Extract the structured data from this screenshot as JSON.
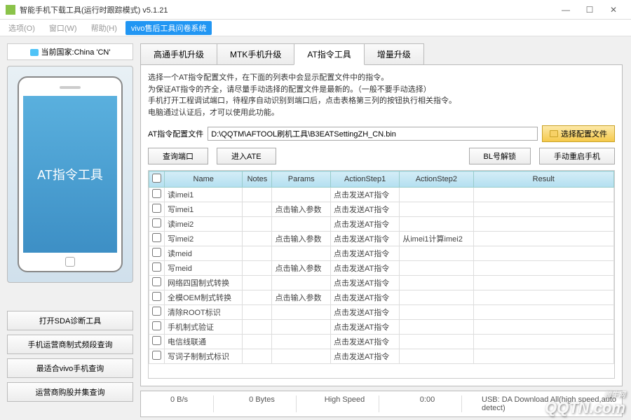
{
  "window": {
    "title": "智能手机下载工具(运行时跟踪模式)  v5.1.21",
    "min": "—",
    "max": "☐",
    "close": "✕"
  },
  "menu": {
    "select": "选项(O)",
    "window": "窗口(W)",
    "help": "帮助(H)",
    "vivo": "vivo售后工具问卷系统"
  },
  "sidebar": {
    "country": "当前国家:China 'CN'",
    "phone_label": "AT指令工具",
    "btns": [
      "打开SDA诊断工具",
      "手机运营商制式频段查询",
      "最适合vivo手机查询",
      "运营商购股并集查询"
    ]
  },
  "tabs": [
    "高通手机升级",
    "MTK手机升级",
    "AT指令工具",
    "增量升级"
  ],
  "panel": {
    "desc_l1": "选择一个AT指令配置文件，在下面的列表中会显示配置文件中的指令。",
    "desc_l2": "为保证AT指令的齐全，请尽量手动选择的配置文件是最新的。（一般不要手动选择）",
    "desc_l3": "手机打开工程调试端口，待程序自动识别到端口后，点击表格第三列的按钮执行相关指令。",
    "desc_l4": "电脑通过认证后，才可以使用此功能。",
    "cfg_label": "AT指令配置文件",
    "cfg_path": "D:\\QQTM\\AFTOOL刷机工具\\B3EATSettingZH_CN.bin",
    "cfg_btn": "选择配置文件",
    "btn_query": "查询端口",
    "btn_ate": "进入ATE",
    "btn_unlock": "BL号解锁",
    "btn_reboot": "手动重启手机",
    "headers": [
      "",
      "Name",
      "Notes",
      "Params",
      "ActionStep1",
      "ActionStep2",
      "Result"
    ],
    "rows": [
      {
        "name": "读imei1",
        "notes": "",
        "params": "",
        "a1": "点击发送AT指令",
        "a2": ""
      },
      {
        "name": "写imei1",
        "notes": "",
        "params": "点击输入参数",
        "a1": "点击发送AT指令",
        "a2": ""
      },
      {
        "name": "读imei2",
        "notes": "",
        "params": "",
        "a1": "点击发送AT指令",
        "a2": ""
      },
      {
        "name": "写imei2",
        "notes": "",
        "params": "点击输入参数",
        "a1": "点击发送AT指令",
        "a2": "从imei1计算imei2"
      },
      {
        "name": "读meid",
        "notes": "",
        "params": "",
        "a1": "点击发送AT指令",
        "a2": ""
      },
      {
        "name": "写meid",
        "notes": "",
        "params": "点击输入参数",
        "a1": "点击发送AT指令",
        "a2": ""
      },
      {
        "name": "网络四国制式转换",
        "notes": "",
        "params": "",
        "a1": "点击发送AT指令",
        "a2": ""
      },
      {
        "name": "全模OEM制式转换",
        "notes": "",
        "params": "点击输入参数",
        "a1": "点击发送AT指令",
        "a2": ""
      },
      {
        "name": "清除ROOT标识",
        "notes": "",
        "params": "",
        "a1": "点击发送AT指令",
        "a2": ""
      },
      {
        "name": "手机制式验证",
        "notes": "",
        "params": "",
        "a1": "点击发送AT指令",
        "a2": ""
      },
      {
        "name": "电信线联通",
        "notes": "",
        "params": "",
        "a1": "点击发送AT指令",
        "a2": ""
      },
      {
        "name": "写词子制制式标识",
        "notes": "",
        "params": "",
        "a1": "点击发送AT指令",
        "a2": ""
      }
    ]
  },
  "status": {
    "speed": "0 B/s",
    "bytes": "0 Bytes",
    "mode": "High Speed",
    "time": "0:00",
    "usb": "USB: DA Download All(high speed,auto detect)"
  },
  "watermark": {
    "cn": "腾牛网",
    "en": "QQTN.com"
  }
}
